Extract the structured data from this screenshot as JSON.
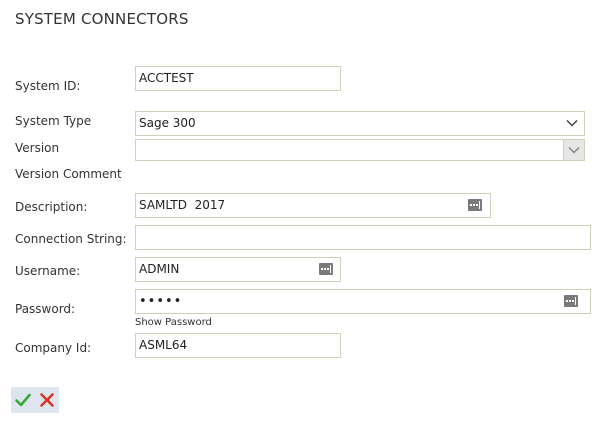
{
  "page": {
    "title": "SYSTEM CONNECTORS"
  },
  "form": {
    "system_id": {
      "label": "System ID:",
      "value": "ACCTEST"
    },
    "system_type": {
      "label": "System Type",
      "value": "Sage 300"
    },
    "version": {
      "label": "Version",
      "value": ""
    },
    "version_comment": {
      "label": "Version Comment"
    },
    "description": {
      "label": "Description:",
      "value": "SAMLTD  2017"
    },
    "connection_string": {
      "label": "Connection String:",
      "value": ""
    },
    "username": {
      "label": "Username:",
      "value": "ADMIN"
    },
    "password": {
      "label": "Password:",
      "value": "•••••",
      "show_label": "Show Password"
    },
    "company_id": {
      "label": "Company Id:",
      "value": "ASML64"
    }
  },
  "actions": {
    "save_icon": "check-icon",
    "cancel_icon": "x-icon",
    "save_color": "#3aa63a",
    "cancel_color": "#d9352a"
  }
}
